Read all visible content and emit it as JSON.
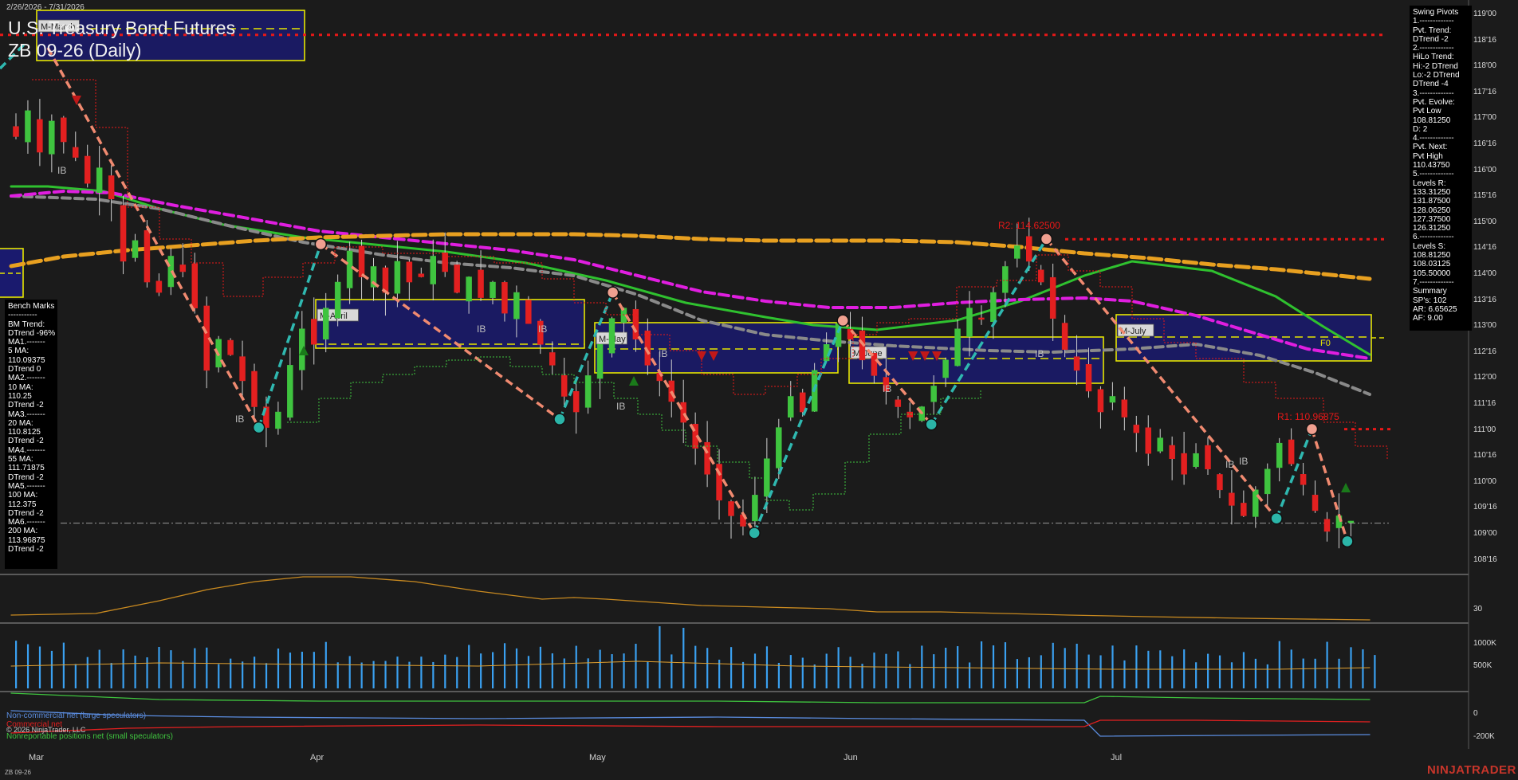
{
  "header": {
    "date_range": "2/26/2026 - 7/31/2026",
    "title_line1": "U.S. Treasury Bond Futures",
    "title_line2": "ZB 09-26 (Daily)"
  },
  "benchmarks": {
    "lines": [
      "Bench Marks",
      "-----------",
      "BM Trend:",
      "DTrend -96%",
      "MA1.-------",
      "5 MA:",
      "110.09375",
      "DTrend 0",
      "MA2.-------",
      "10 MA:",
      "110.25",
      "DTrend -2",
      "MA3.-------",
      "20 MA:",
      "110.8125",
      "DTrend -2",
      "MA4.-------",
      "55 MA:",
      "111.71875",
      "DTrend -2",
      "MA5.-------",
      "100 MA:",
      "112.375",
      "DTrend -2",
      "MA6.-------",
      "200 MA:",
      "113.96875",
      "DTrend -2"
    ]
  },
  "swing_pivots": {
    "lines": [
      "Swing Pivots",
      "1.-------------",
      "Pvt. Trend:",
      "DTrend -2",
      "2.-------------",
      "HiLo Trend:",
      "Hi:-2 DTrend",
      "Lo:-2 DTrend",
      "DTrend -4",
      "3.-------------",
      "Pvt. Evolve:",
      "Pvt Low",
      "108.81250",
      "D: 2",
      "4.-------------",
      "Pvt. Next:",
      "Pvt High",
      "110.43750",
      "5.-------------",
      "Levels R:",
      "133.31250",
      "131.87500",
      "128.06250",
      "127.37500",
      "126.31250",
      "6.-------------",
      "Levels S:",
      "108.81250",
      "108.03125",
      "105.50000",
      "7.-------------",
      "Summary",
      "SP's: 102",
      "AR: 6.65625",
      "AF: 9.00"
    ]
  },
  "price_axis": [
    "119'00",
    "118'16",
    "118'00",
    "117'16",
    "117'00",
    "116'16",
    "116'00",
    "115'16",
    "115'00",
    "114'16",
    "114'00",
    "113'16",
    "113'00",
    "112'16",
    "112'00",
    "111'16",
    "111'00",
    "110'16",
    "110'00",
    "109'16",
    "109'00",
    "108'16"
  ],
  "indicator_axis": [
    "30"
  ],
  "volume_axis": [
    "1000K",
    "500K"
  ],
  "cot_axis": [
    "0",
    "-200K"
  ],
  "x_axis": [
    "Mar",
    "Apr",
    "May",
    "Jun",
    "Jul"
  ],
  "annotations": {
    "r2": "R2: 114.62500",
    "r1": "R1: 110.96875",
    "ib": "IB",
    "f0": "F0",
    "month_boxes": [
      "M-March",
      "M-April",
      "M-May",
      "M-June",
      "M-July"
    ]
  },
  "cot_legend": {
    "noncommercial": "Non-commercial net (large speculators)",
    "commercial": "Commercial net",
    "nonreportable": "Nonreportable positions net (small speculators)"
  },
  "footer": {
    "copyright": "© 2026 NinjaTrader, LLC",
    "symbol": "ZB 09-26",
    "logo": "NINJATRADER"
  },
  "colors": {
    "up": "#3fc43f",
    "down": "#e32020",
    "ma20": "#2fc12f",
    "ma100": "#e01ee0",
    "ma200": "#e8a020",
    "ma55": "#8a8a8a",
    "swing_up": "#2fb8b0",
    "swing_down": "#f08a70",
    "resistance": "#e81818",
    "range_box": "#1a1a6e",
    "range_border": "#e6e600",
    "volume": "#3aa0f0",
    "oscillator": "#c98a20"
  },
  "chart_data": {
    "type": "candlestick",
    "x_label_dates": [
      "Mar",
      "Apr",
      "May",
      "Jun",
      "Jul"
    ],
    "y_range": [
      108.25,
      119.0
    ],
    "pivots": [
      {
        "date": "2026-03-27",
        "price": 111.0,
        "kind": "low"
      },
      {
        "date": "2026-04-03",
        "price": 114.53,
        "kind": "high"
      },
      {
        "date": "2026-04-30",
        "price": 111.16,
        "kind": "low"
      },
      {
        "date": "2026-05-06",
        "price": 113.6,
        "kind": "high"
      },
      {
        "date": "2026-05-22",
        "price": 108.97,
        "kind": "low"
      },
      {
        "date": "2026-06-01",
        "price": 113.06,
        "kind": "high"
      },
      {
        "date": "2026-06-11",
        "price": 111.06,
        "kind": "low"
      },
      {
        "date": "2026-06-24",
        "price": 114.63,
        "kind": "high"
      },
      {
        "date": "2026-07-20",
        "price": 109.25,
        "kind": "low"
      },
      {
        "date": "2026-07-24",
        "price": 110.97,
        "kind": "high"
      },
      {
        "date": "2026-07-28",
        "price": 108.81,
        "kind": "low"
      }
    ],
    "levels": {
      "r2": 114.625,
      "r1": 110.96875,
      "dotted_top": 118.56,
      "reference": 109.16
    },
    "moving_averages": {
      "ma20": 110.8125,
      "ma55": 111.71875,
      "ma100": 112.375,
      "ma200": 113.96875
    }
  }
}
